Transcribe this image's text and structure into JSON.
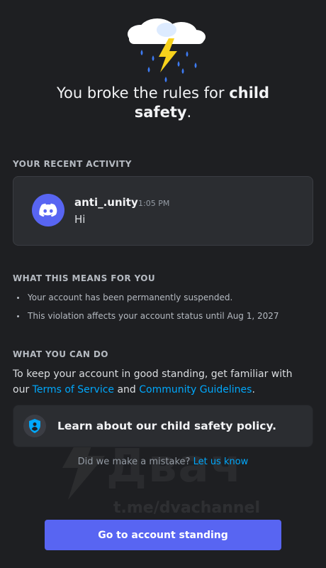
{
  "headline": {
    "prefix": "You broke the rules for ",
    "bold1": "child",
    "bold2": "safety",
    "suffix": "."
  },
  "recent_activity": {
    "title": "YOUR RECENT ACTIVITY",
    "message": {
      "username": "anti_.unity",
      "timestamp": "1:05 PM",
      "text": "Hi",
      "avatar_icon": "discord-logo-icon"
    }
  },
  "meaning": {
    "title": "WHAT THIS MEANS FOR YOU",
    "items": [
      "Your account has been permanently suspended.",
      "This violation affects your account status until Aug 1, 2027"
    ]
  },
  "can_do": {
    "title": "WHAT YOU CAN DO",
    "text_before": "To keep your account in good standing, get familiar with our ",
    "tos_link": "Terms of Service",
    "text_mid": " and ",
    "guidelines_link": "Community Guidelines",
    "text_after": "."
  },
  "policy_card": {
    "icon": "shield-icon",
    "label": "Learn about our child safety policy."
  },
  "mistake": {
    "text": "Did we make a mistake? ",
    "link": "Let us know"
  },
  "watermark": {
    "big": "Двач",
    "small": "t.me/dvachannel"
  },
  "cta": {
    "label": "Go to account standing"
  },
  "colors": {
    "background": "#1e1f22",
    "card": "#2b2d31",
    "brand": "#5865f2",
    "link": "#00a8fc"
  }
}
